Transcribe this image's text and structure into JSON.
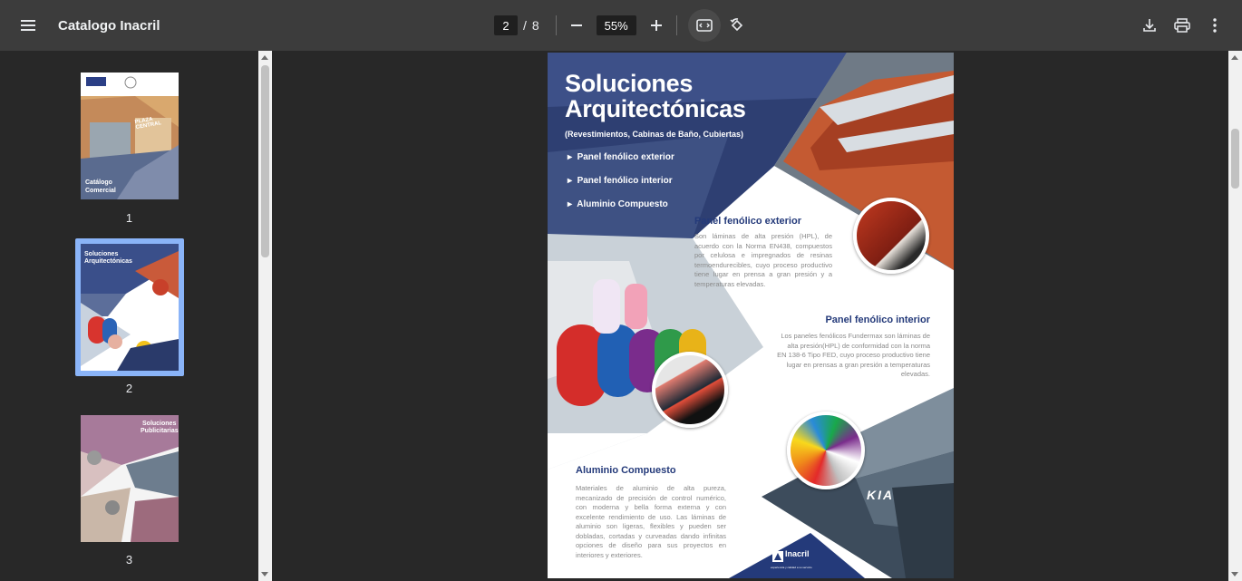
{
  "toolbar": {
    "title": "Catalogo Inacril",
    "current_page": "2",
    "separator": "/",
    "total_pages": "8",
    "zoom": "55%",
    "icons": [
      "menu-icon",
      "zoom-out-icon",
      "zoom-in-icon",
      "fit-page-icon",
      "rotate-icon",
      "download-icon",
      "print-icon",
      "more-icon"
    ]
  },
  "sidebar": {
    "thumbnails": [
      {
        "number": "1",
        "label_a": "Catálogo",
        "label_b": "Comercial",
        "sign": "PLAZA CENTRAL"
      },
      {
        "number": "2",
        "label_a": "Soluciones",
        "label_b": "Arquitectónicas"
      },
      {
        "number": "3",
        "label_a": "Soluciones",
        "label_b": "Publicitarias"
      }
    ]
  },
  "page": {
    "title_line1": "Soluciones",
    "title_line2": "Arquitectónicas",
    "subtitle": "(Revestimientos, Cabinas de Baño, Cubiertas)",
    "bullets": [
      "Panel fenólico exterior",
      "Panel fenólico interior",
      "Aluminio Compuesto"
    ],
    "sections": [
      {
        "heading": "Panel fenólico exterior",
        "text": "Son láminas de alta presión (HPL), de acuerdo con la Norma EN438, compuestos por celulosa e impregnados de resinas termoendurecibles, cuyo proceso productivo tiene lugar en prensa a gran presión y a temperaturas elevadas."
      },
      {
        "heading": "Panel fenólico interior",
        "text": "Los paneles fenólicos Fundermax son láminas de alta presión(HPL) de conformidad con la norma EN 138-6 Tipo FED, cuyo proceso productivo tiene lugar en prensas a gran presión a temperaturas elevadas."
      },
      {
        "heading": "Aluminio Compuesto",
        "text": "Materiales de aluminio de alta pureza, mecanizado de precisión de control numérico, con moderna y bella forma externa y con excelente rendimiento de uso. Las láminas de aluminio son ligeras, flexibles y pueden ser dobladas, cortadas y curveadas dando infinitas opciones de diseño para sus proyectos en interiores y exteriores."
      }
    ],
    "logo_text": "Inacril",
    "logo_tagline": "experiencia y calidad a su servicio",
    "sign_text": "KIA"
  },
  "colors": {
    "toolbar_bg": "#3c3c3c",
    "viewer_bg": "#282828",
    "accent_navy": "#243a7a",
    "selected_thumb": "#8ab4f8"
  }
}
